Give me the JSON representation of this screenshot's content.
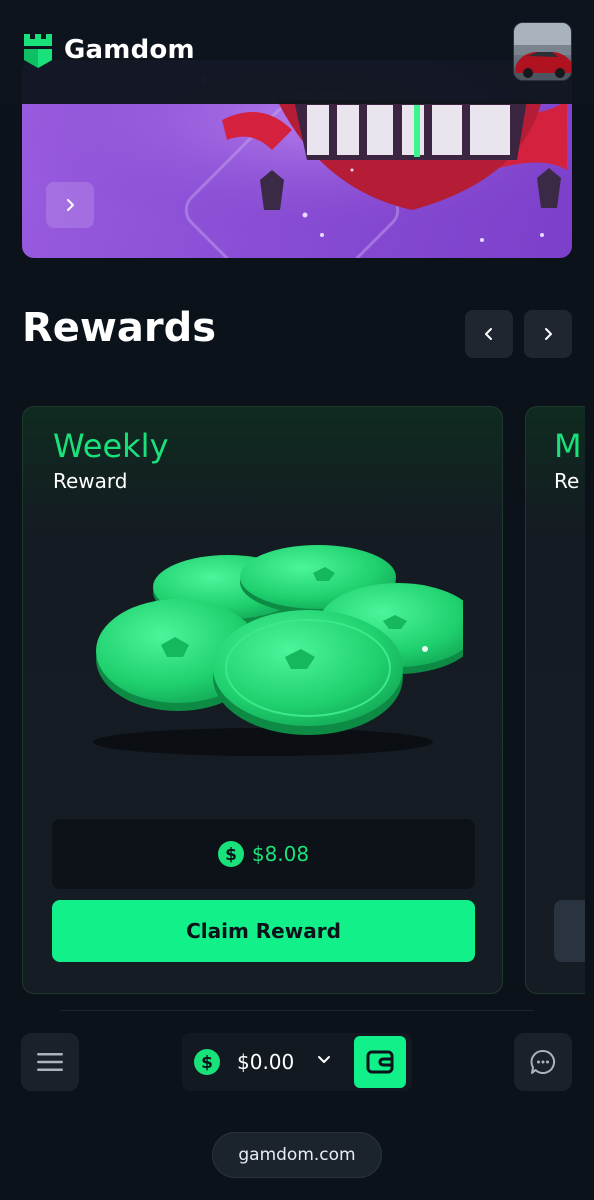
{
  "header": {
    "brand": "Gamdom",
    "logo_icon": "castle-logo-icon",
    "avatar_icon": "user-avatar-car-photo",
    "accent_color": "#12f08a"
  },
  "banner": {
    "next_icon": "chevron-right-icon",
    "background_color": "#8a4fd6"
  },
  "rewards": {
    "title": "Rewards",
    "prev_icon": "chevron-left-icon",
    "next_icon": "chevron-right-icon",
    "cards": [
      {
        "type": "Weekly",
        "subtitle": "Reward",
        "image_icon": "green-coins-illustration",
        "currency_icon": "dollar-coin-icon",
        "amount": "$8.08",
        "button_label": "Claim Reward"
      },
      {
        "type": "M",
        "subtitle": "Re"
      }
    ]
  },
  "bottom_bar": {
    "menu_icon": "hamburger-menu-icon",
    "currency_icon": "dollar-coin-icon",
    "balance": "$0.00",
    "dropdown_icon": "chevron-down-icon",
    "wallet_icon": "wallet-icon",
    "chat_icon": "chat-bubble-icon"
  },
  "browser": {
    "url": "gamdom.com"
  }
}
